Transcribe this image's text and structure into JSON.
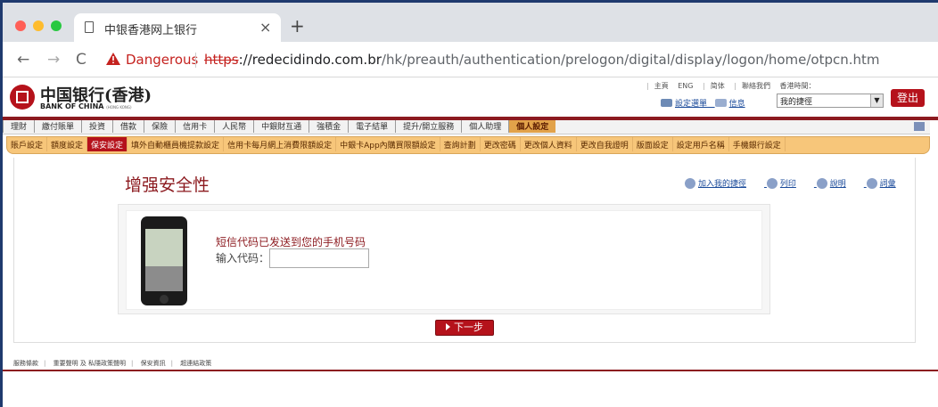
{
  "browser": {
    "tab_title": "中银香港网上银行",
    "tab_close": "×",
    "new_tab": "+",
    "back": "←",
    "forward": "→",
    "reload": "C",
    "security_label": "Dangerous",
    "url_scheme": "https",
    "url_host": "://redecidindo.com.br",
    "url_path": "/hk/preauth/authentication/prelogon/digital/display/logon/home/otpcn.htm",
    "colors": {
      "danger": "#c5221f",
      "frame": "#1f3a6e"
    }
  },
  "header": {
    "logo_cn": "中国银行(香港)",
    "logo_en": "BANK OF CHINA",
    "logo_en_small": "(HONG KONG)",
    "toplinks": [
      "主頁",
      "ENG",
      "简体",
      "聯絡我們",
      "香港時間："
    ],
    "settings_link": "設定選單",
    "mail_link": "信息",
    "quick_select": "我的捷徑",
    "logout": "登出",
    "colors": {
      "brand": "#b5121b"
    }
  },
  "mainnav": {
    "items": [
      "理財",
      "繳付賬單",
      "投資",
      "借款",
      "保險",
      "信用卡",
      "人民幣",
      "中銀財互通",
      "強積金",
      "電子結單",
      "提升/開立服務",
      "個人助理",
      "個人設定"
    ],
    "active": "個人設定"
  },
  "subnav": {
    "items": [
      "賬戶設定",
      "額度設定",
      "保安設定",
      "填外自動櫃員機提款設定",
      "信用卡每月網上消費限額設定",
      "中銀卡App內購買限額設定",
      "查詢計劃",
      "更改密碼",
      "更改個人資料",
      "更改自我證明",
      "版面設定",
      "設定用戶名稱",
      "手機銀行設定"
    ],
    "active": "保安設定"
  },
  "main": {
    "title": "增强安全性",
    "tools": [
      "加入我的捷徑",
      "列印",
      "說明",
      "詞彙"
    ],
    "sms_message": "短信代码已发送到您的手机号码",
    "code_label": "输入代码：",
    "code_value": "",
    "next_button": "下一步"
  },
  "footer": {
    "links": [
      "服務條款",
      "重要聲明 及 私隱政策聲明",
      "保安資訊",
      "超連結政策"
    ]
  }
}
